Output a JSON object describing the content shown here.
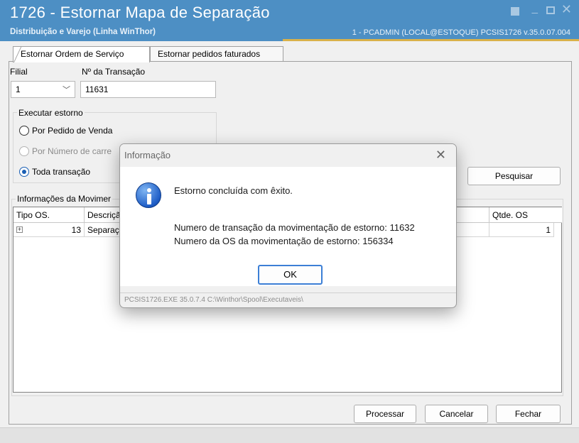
{
  "window": {
    "title": "1726 - Estornar Mapa de Separação",
    "subtitle": "Distribuição e Varejo (Linha WinThor)",
    "status": "1 - PCADMIN (LOCAL@ESTOQUE)   PCSIS1726  v.35.0.07.004"
  },
  "tabs": [
    {
      "label": "Estornar Ordem de Serviço",
      "active": true
    },
    {
      "label": "Estornar pedidos faturados",
      "active": false
    }
  ],
  "form": {
    "filial_label": "Filial",
    "filial_value": "1",
    "transacao_label": "Nº da Transação",
    "transacao_value": "11631",
    "executar_label": "Executar estorno",
    "options": [
      {
        "label": "Por Pedido de Venda",
        "checked": false,
        "disabled": false
      },
      {
        "label": "Por Número de carre",
        "checked": false,
        "disabled": true
      },
      {
        "label": "Toda transação",
        "checked": true,
        "disabled": false
      }
    ],
    "pesquisar_label": "Pesquisar"
  },
  "grid": {
    "section_label": "Informações da Movimer",
    "columns": [
      "Tipo OS.",
      "Descriçã",
      "Qtde. OS"
    ],
    "rows": [
      {
        "tipo": "13",
        "descricao": "Separaç",
        "qtde": "1"
      }
    ]
  },
  "buttons": {
    "processar": "Processar",
    "cancelar": "Cancelar",
    "fechar": "Fechar"
  },
  "dialog": {
    "title": "Informação",
    "heading": "Estorno concluída com êxito.",
    "line1": "Numero de transação da movimentação de estorno: 11632",
    "line2": "Numero da OS da movimentação de estorno: 156334",
    "ok_label": "OK",
    "footer": "PCSIS1726.EXE 35.0.7.4 C:\\Winthor\\Spool\\Executaveis\\"
  },
  "colors": {
    "titlebar": "#4d8fc4",
    "accent": "#1a5fb4",
    "gold": "#d9b14a"
  }
}
